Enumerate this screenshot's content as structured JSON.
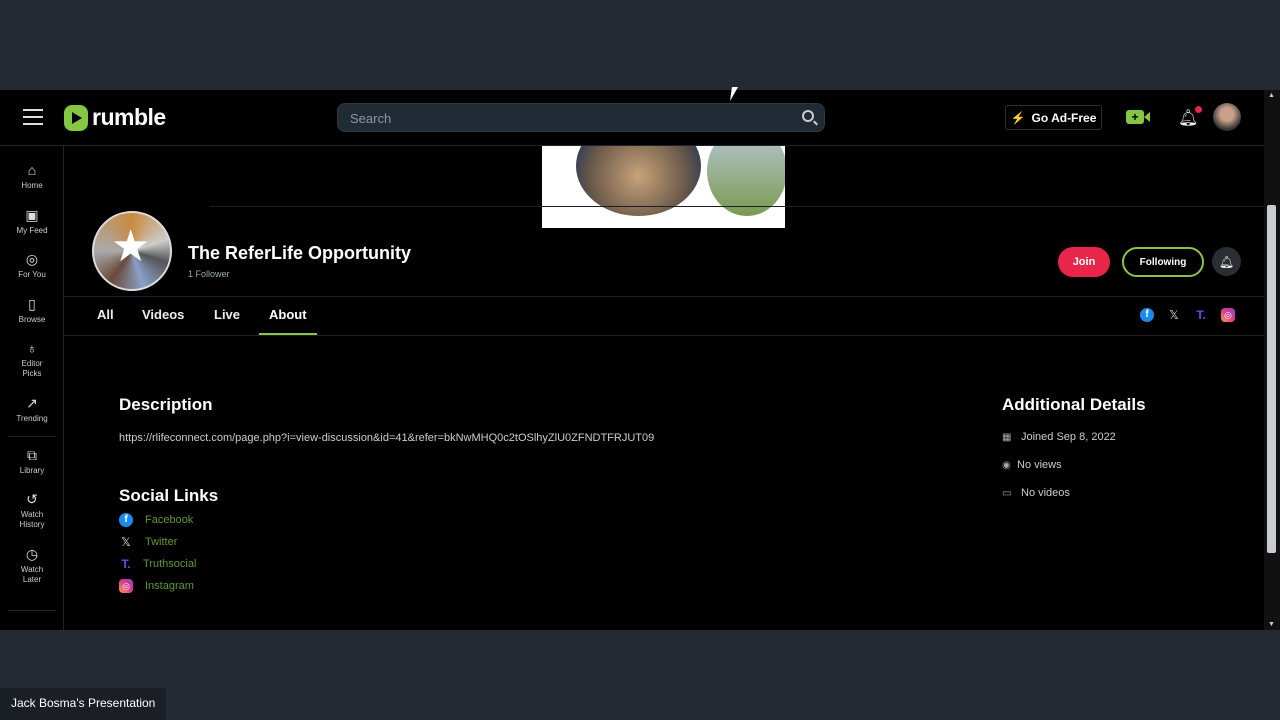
{
  "header": {
    "brand": "rumble",
    "search_placeholder": "Search",
    "go_ad_free": "Go Ad-Free"
  },
  "sidebar": {
    "items": [
      {
        "label": "Home",
        "icon": "home-icon"
      },
      {
        "label": "My Feed",
        "icon": "feed-icon"
      },
      {
        "label": "For You",
        "icon": "target-icon"
      },
      {
        "label": "Browse",
        "icon": "browse-icon"
      },
      {
        "label": "Editor Picks",
        "icon": "award-icon"
      },
      {
        "label": "Trending",
        "icon": "trending-icon"
      },
      {
        "label": "Library",
        "icon": "library-icon"
      },
      {
        "label": "Watch History",
        "icon": "history-icon"
      },
      {
        "label": "Watch Later",
        "icon": "clock-icon"
      }
    ]
  },
  "channel": {
    "name": "The ReferLife Opportunity",
    "followers": "1 Follower",
    "join": "Join",
    "following": "Following"
  },
  "tabs": [
    {
      "label": "All"
    },
    {
      "label": "Videos"
    },
    {
      "label": "Live"
    },
    {
      "label": "About",
      "active": true
    }
  ],
  "about": {
    "description_title": "Description",
    "description": "https://rlifeconnect.com/page.php?i=view-discussion&id=41&refer=bkNwMHQ0c2tOSlhyZlU0ZFNDTFRJUT09",
    "social_title": "Social Links",
    "social": [
      {
        "label": "Facebook"
      },
      {
        "label": "Twitter"
      },
      {
        "label": "Truthsocial"
      },
      {
        "label": "Instagram"
      }
    ],
    "details_title": "Additional Details",
    "details": [
      {
        "label": "Joined Sep 8, 2022",
        "icon": "calendar-icon"
      },
      {
        "label": "No views",
        "icon": "eye-icon"
      },
      {
        "label": "No videos",
        "icon": "video-icon"
      }
    ]
  },
  "colors": {
    "accent": "#85c742",
    "join": "#e8264a",
    "background": "#000000"
  },
  "presenter": "Jack Bosma's Presentation"
}
